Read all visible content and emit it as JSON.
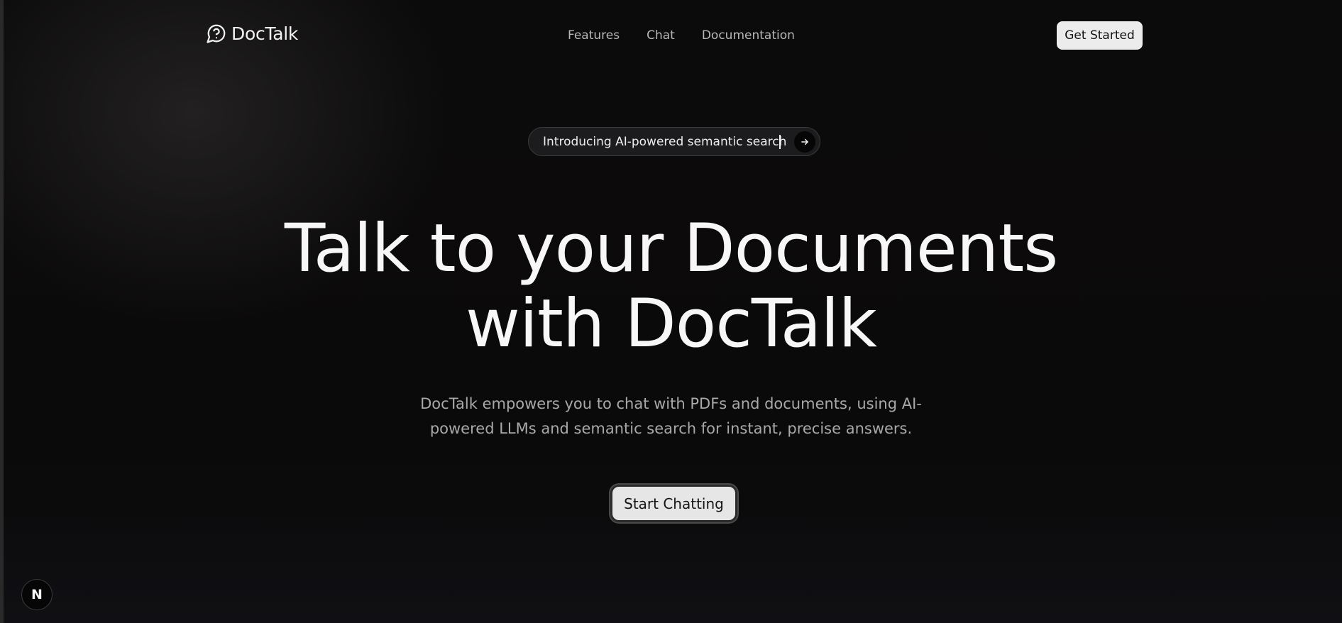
{
  "header": {
    "brand": "DocTalk",
    "brand_icon": "chat-question-icon",
    "nav": [
      {
        "label": "Features"
      },
      {
        "label": "Chat"
      },
      {
        "label": "Documentation"
      }
    ],
    "cta_label": "Get Started"
  },
  "announcement": {
    "text": "Introducing AI-powered semantic search",
    "icon": "arrow-right-icon"
  },
  "hero": {
    "title_line1": "Talk to your Documents",
    "title_line2": "with DocTalk",
    "subtitle": "DocTalk empowers you to chat with PDFs and documents, using AI-powered LLMs and semantic search for instant, precise answers.",
    "cta_label": "Start Chatting"
  },
  "dev_badge": {
    "letter": "N"
  },
  "colors": {
    "background": "#0b0a0a",
    "button_bg": "#ececec",
    "text_primary": "#f7f7f7",
    "text_muted": "#a9a9a9"
  }
}
